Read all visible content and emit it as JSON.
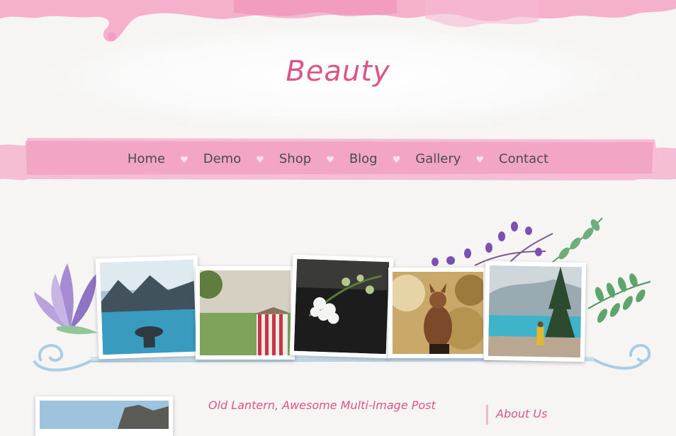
{
  "site": {
    "title": "Beauty"
  },
  "nav": {
    "items": [
      {
        "label": "Home"
      },
      {
        "label": "Demo"
      },
      {
        "label": "Shop"
      },
      {
        "label": "Blog"
      },
      {
        "label": "Gallery"
      },
      {
        "label": "Contact"
      }
    ],
    "separator": "♥"
  },
  "colors": {
    "accent": "#d9558a",
    "nav_band": "#f4a9c8",
    "nav_text": "#4a4a55",
    "swirl": "#a9cde6"
  },
  "gallery": {
    "photos": [
      {
        "subject": "mountain-lake-binoculars"
      },
      {
        "subject": "striped-beach-hut"
      },
      {
        "subject": "white-blossoms"
      },
      {
        "subject": "squirrel"
      },
      {
        "subject": "hiker-by-lake"
      }
    ],
    "decorations": [
      "purple-flower-icon",
      "lavender-sprig-icon",
      "green-leaf-icon",
      "blue-swirl-icon"
    ]
  },
  "post": {
    "title": "Old Lantern, Awesome Multi-Image Post"
  },
  "sidebar": {
    "widget_title": "About Us"
  }
}
